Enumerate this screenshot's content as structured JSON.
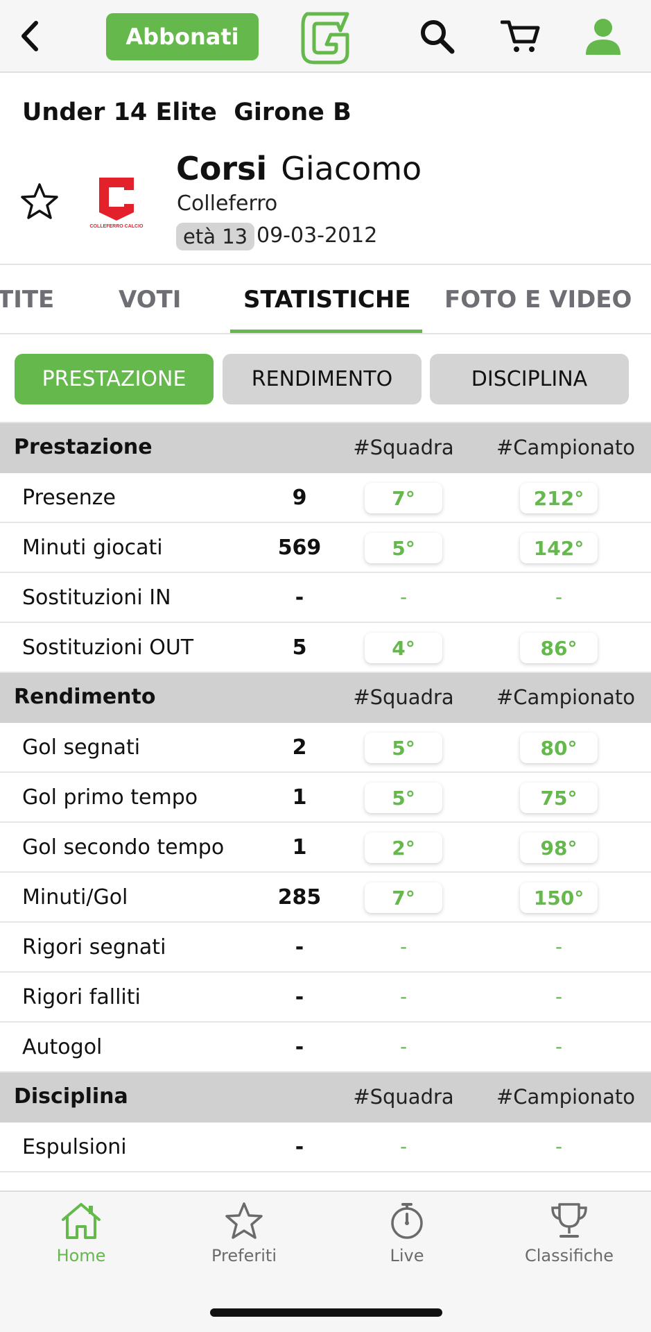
{
  "topbar": {
    "back_icon": "chevron-left-icon",
    "subscribe_label": "Abbonati",
    "logo_icon": "app-logo-g",
    "search_icon": "search-icon",
    "cart_icon": "cart-icon",
    "account_icon": "user-icon"
  },
  "colors": {
    "accent": "#65b84b",
    "section_bg": "#d0d0d0",
    "club_red": "#e3212b"
  },
  "header": {
    "league": "Under 14 Elite  Girone B",
    "surname": "Corsi",
    "first_name": "Giacomo",
    "club": "Colleferro",
    "club_logo_text": "COLLEFERRO CALCIO",
    "age_badge": "età 13",
    "birth_date": "09-03-2012",
    "favorite_icon": "star-outline-icon"
  },
  "tabs": [
    {
      "label": "TITE",
      "active": false
    },
    {
      "label": "VOTI",
      "active": false
    },
    {
      "label": "STATISTICHE",
      "active": true
    },
    {
      "label": "FOTO E VIDEO",
      "active": false
    }
  ],
  "segments": [
    {
      "label": "PRESTAZIONE",
      "active": true
    },
    {
      "label": "RENDIMENTO",
      "active": false
    },
    {
      "label": "DISCIPLINA",
      "active": false
    }
  ],
  "sections": [
    {
      "title": "Prestazione",
      "col_squadra": "#Squadra",
      "col_campionato": "#Campionato",
      "rows": [
        {
          "label": "Presenze",
          "value": "9",
          "squadra": "7°",
          "campionato": "212°"
        },
        {
          "label": "Minuti giocati",
          "value": "569",
          "squadra": "5°",
          "campionato": "142°"
        },
        {
          "label": "Sostituzioni IN",
          "value": "-",
          "squadra": "-",
          "campionato": "-"
        },
        {
          "label": "Sostituzioni OUT",
          "value": "5",
          "squadra": "4°",
          "campionato": "86°"
        }
      ]
    },
    {
      "title": "Rendimento",
      "col_squadra": "#Squadra",
      "col_campionato": "#Campionato",
      "rows": [
        {
          "label": "Gol segnati",
          "value": "2",
          "squadra": "5°",
          "campionato": "80°"
        },
        {
          "label": "Gol primo tempo",
          "value": "1",
          "squadra": "5°",
          "campionato": "75°"
        },
        {
          "label": "Gol secondo tempo",
          "value": "1",
          "squadra": "2°",
          "campionato": "98°"
        },
        {
          "label": "Minuti/Gol",
          "value": "285",
          "squadra": "7°",
          "campionato": "150°"
        },
        {
          "label": "Rigori segnati",
          "value": "-",
          "squadra": "-",
          "campionato": "-"
        },
        {
          "label": "Rigori falliti",
          "value": "-",
          "squadra": "-",
          "campionato": "-"
        },
        {
          "label": "Autogol",
          "value": "-",
          "squadra": "-",
          "campionato": "-"
        }
      ]
    },
    {
      "title": "Disciplina",
      "col_squadra": "#Squadra",
      "col_campionato": "#Campionato",
      "rows": [
        {
          "label": "Espulsioni",
          "value": "-",
          "squadra": "-",
          "campionato": "-"
        }
      ]
    }
  ],
  "bottom_nav": [
    {
      "label": "Home",
      "icon": "home-icon",
      "active": true
    },
    {
      "label": "Preferiti",
      "icon": "star-icon",
      "active": false
    },
    {
      "label": "Live",
      "icon": "stopwatch-icon",
      "active": false
    },
    {
      "label": "Classifiche",
      "icon": "trophy-icon",
      "active": false
    }
  ]
}
